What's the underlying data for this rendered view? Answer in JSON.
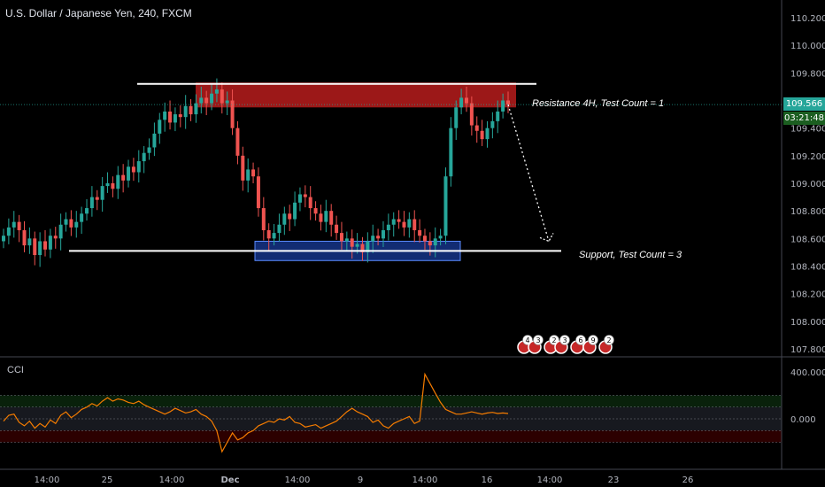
{
  "header": {
    "title": "U.S. Dollar / Japanese Yen, 240, FXCM"
  },
  "annotations": {
    "resistance": "Resistance 4H, Test Count = 1",
    "support": "Support, Test Count = 3"
  },
  "indicator": {
    "label": "CCI",
    "ticks": [
      "400.000",
      "0.000"
    ]
  },
  "price_tags": {
    "last_price": "109.566",
    "countdown": "03:21:48"
  },
  "colors": {
    "up": "#26a69a",
    "down": "#ef5350",
    "cci_line": "#f57c00",
    "resistance_zone": "#b71c1c",
    "support_zone": "#2962ff",
    "price_tag": "#26a69a",
    "countdown_tag": "#1b5e20"
  },
  "event_flags": [
    {
      "label": "4"
    },
    {
      "label": "3"
    },
    {
      "label": "2"
    },
    {
      "label": "3"
    },
    {
      "label": "6"
    },
    {
      "label": "9"
    },
    {
      "label": "2"
    }
  ],
  "chart_data": {
    "type": "candlestick",
    "title": "U.S. Dollar / Japanese Yen, 240, FXCM",
    "y_ticks": [
      "110.200",
      "110.000",
      "109.800",
      "109.400",
      "109.200",
      "109.000",
      "108.800",
      "108.600",
      "108.400",
      "108.200",
      "108.000",
      "107.800"
    ],
    "ylim": [
      107.75,
      110.3
    ],
    "x_ticks": [
      "14:00",
      "25",
      "14:00",
      "Dec",
      "14:00",
      "9",
      "14:00",
      "16",
      "14:00",
      "23",
      "26"
    ],
    "resistance_level": 109.72,
    "resistance_zone": [
      109.55,
      109.73
    ],
    "support_level": 108.51,
    "support_zone": [
      108.44,
      108.58
    ],
    "projection_target": 108.58,
    "close": [
      108.62,
      108.68,
      108.72,
      108.66,
      108.55,
      108.6,
      108.48,
      108.58,
      108.52,
      108.62,
      108.6,
      108.7,
      108.74,
      108.68,
      108.72,
      108.78,
      108.82,
      108.9,
      108.88,
      108.98,
      109.0,
      108.96,
      109.06,
      109.02,
      109.12,
      109.08,
      109.16,
      109.22,
      109.26,
      109.36,
      109.46,
      109.52,
      109.44,
      109.5,
      109.48,
      109.56,
      109.5,
      109.58,
      109.62,
      109.58,
      109.65,
      109.68,
      109.58,
      109.6,
      109.4,
      109.2,
      109.02,
      109.1,
      109.05,
      108.82,
      108.66,
      108.6,
      108.64,
      108.7,
      108.78,
      108.74,
      108.86,
      108.92,
      108.9,
      108.82,
      108.78,
      108.72,
      108.8,
      108.7,
      108.64,
      108.58,
      108.6,
      108.54,
      108.56,
      108.5,
      108.58,
      108.62,
      108.6,
      108.66,
      108.7,
      108.74,
      108.72,
      108.68,
      108.74,
      108.66,
      108.62,
      108.58,
      108.55,
      108.6,
      108.62,
      109.05,
      109.4,
      109.55,
      109.62,
      109.58,
      109.42,
      109.38,
      109.32,
      109.4,
      109.45,
      109.52,
      109.6,
      109.57
    ]
  },
  "cci_data": {
    "ylim": [
      -350,
      500
    ],
    "upper_level": 100,
    "lower_level": -100,
    "values": [
      -20,
      30,
      40,
      -30,
      -60,
      -20,
      -80,
      -40,
      -70,
      -10,
      -40,
      30,
      60,
      10,
      40,
      80,
      100,
      130,
      110,
      150,
      180,
      150,
      170,
      160,
      140,
      130,
      150,
      120,
      100,
      80,
      60,
      40,
      60,
      90,
      70,
      50,
      60,
      80,
      40,
      20,
      -20,
      -100,
      -280,
      -200,
      -120,
      -180,
      -160,
      -120,
      -100,
      -60,
      -40,
      -20,
      -30,
      0,
      -10,
      20,
      -30,
      -40,
      -70,
      -60,
      -50,
      -80,
      -60,
      -40,
      -20,
      20,
      60,
      90,
      60,
      40,
      20,
      -30,
      -10,
      -60,
      -80,
      -40,
      -20,
      0,
      20,
      -40,
      -20,
      380,
      300,
      220,
      140,
      80,
      60,
      40,
      40,
      50,
      60,
      50,
      40,
      50,
      55,
      45,
      50,
      45
    ]
  }
}
